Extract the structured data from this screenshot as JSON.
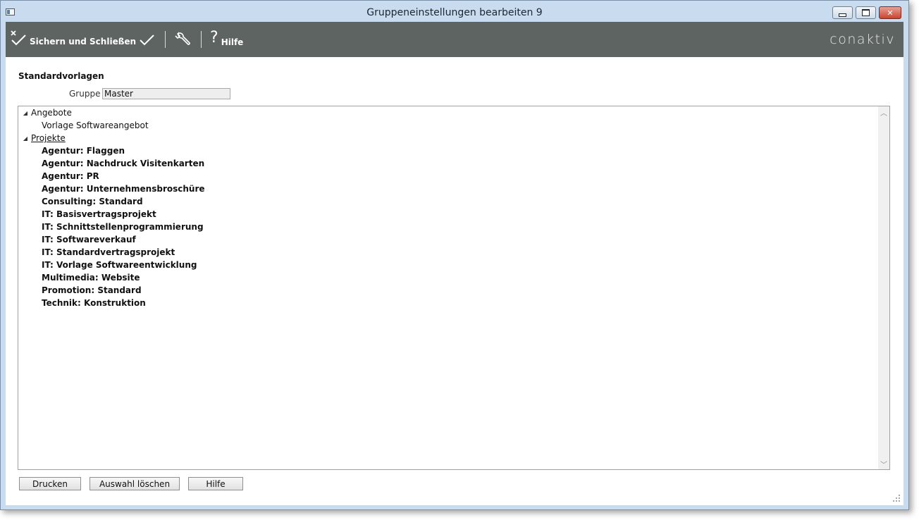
{
  "window": {
    "title": "Gruppeneinstellungen bearbeiten 9"
  },
  "toolbar": {
    "save_close_label": "Sichern und Schließen",
    "help_label": "Hilfe",
    "logo_text": "conaktiv",
    "icons": {
      "save_close": "check-x-icon",
      "save": "check-icon",
      "tools": "wrench-icon",
      "help": "question-icon"
    }
  },
  "form": {
    "section_title": "Standardvorlagen",
    "group_label": "Gruppe",
    "group_value": "Master"
  },
  "tree": {
    "angebote": {
      "label": "Angebote",
      "children": [
        "Vorlage Softwareangebot"
      ]
    },
    "projekte": {
      "label": "Projekte",
      "children": [
        "Agentur: Flaggen",
        "Agentur: Nachdruck Visitenkarten",
        "Agentur: PR",
        "Agentur: Unternehmensbroschüre",
        "Consulting: Standard",
        "IT: Basisvertragsprojekt",
        "IT: Schnittstellenprogrammierung",
        "IT: Softwareverkauf",
        "IT: Standardvertragsprojekt",
        "IT: Vorlage Softwareentwicklung",
        "Multimedia: Website",
        "Promotion: Standard",
        "Technik: Konstruktion"
      ]
    }
  },
  "footer": {
    "print_label": "Drucken",
    "clear_label": "Auswahl löschen",
    "help_label": "Hilfe"
  },
  "colors": {
    "toolbar_bg": "#5e6462",
    "frame": "#c9dcef",
    "close_button": "#c7452f"
  }
}
